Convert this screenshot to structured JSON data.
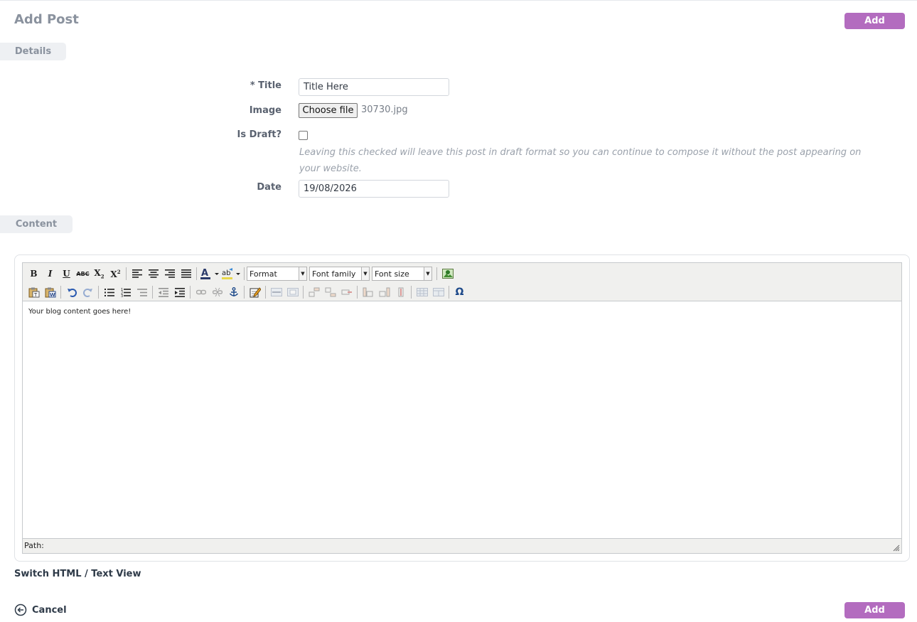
{
  "page": {
    "title": "Add Post",
    "add_label": "Add"
  },
  "sections": {
    "details": "Details",
    "content": "Content"
  },
  "form": {
    "title_label": "* Title",
    "title_value": "Title Here",
    "image_label": "Image",
    "choose_file_label": "Choose file",
    "file_name": "30730.jpg",
    "is_draft_label": "Is Draft?",
    "is_draft_checked": false,
    "is_draft_help": "Leaving this checked will leave this post in draft format so you can continue to compose it without the post appearing on your website.",
    "date_label": "Date",
    "date_value": "19/08/2026"
  },
  "editor": {
    "format_select": "Format",
    "font_family_select": "Font family",
    "font_size_select": "Font size",
    "content": "Your blog content goes here!",
    "path_label": "Path:"
  },
  "footer": {
    "switch_view_label": "Switch HTML / Text View",
    "cancel_label": "Cancel"
  },
  "colors": {
    "accent": "#b36cbf",
    "tab_bg": "#eef0f3"
  }
}
